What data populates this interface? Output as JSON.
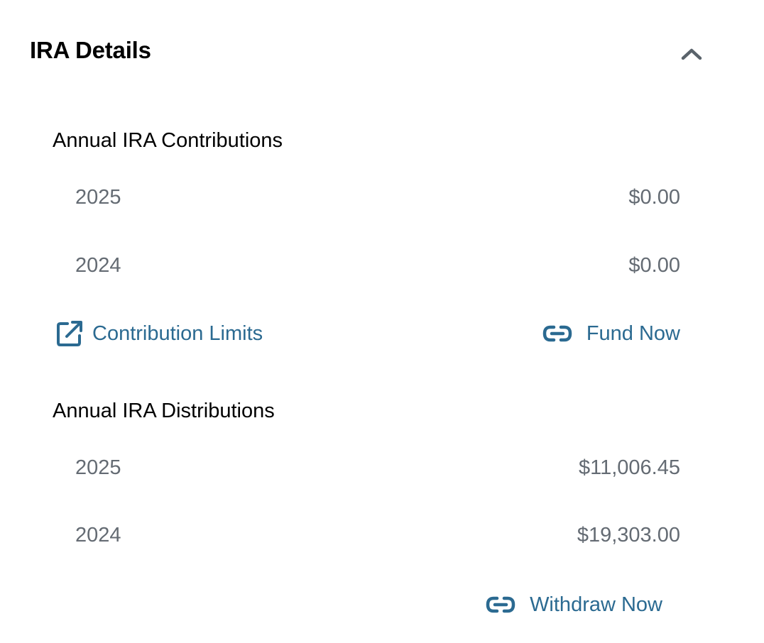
{
  "panel": {
    "title": "IRA Details",
    "collapse_icon": "chevron-up-icon"
  },
  "contributions": {
    "title": "Annual IRA Contributions",
    "rows": [
      {
        "year": "2025",
        "amount": "$0.00"
      },
      {
        "year": "2024",
        "amount": "$0.00"
      }
    ],
    "limits_link": {
      "label": "Contribution Limits",
      "icon": "external-link-icon"
    },
    "fund_link": {
      "label": "Fund Now",
      "icon": "link-icon"
    }
  },
  "distributions": {
    "title": "Annual IRA Distributions",
    "rows": [
      {
        "year": "2025",
        "amount": "$11,006.45"
      },
      {
        "year": "2024",
        "amount": "$19,303.00"
      }
    ],
    "withdraw_link": {
      "label": "Withdraw Now",
      "icon": "link-icon"
    }
  },
  "colors": {
    "link": "#2b6a91",
    "muted_text": "#646b73",
    "chevron": "#5a636b"
  }
}
